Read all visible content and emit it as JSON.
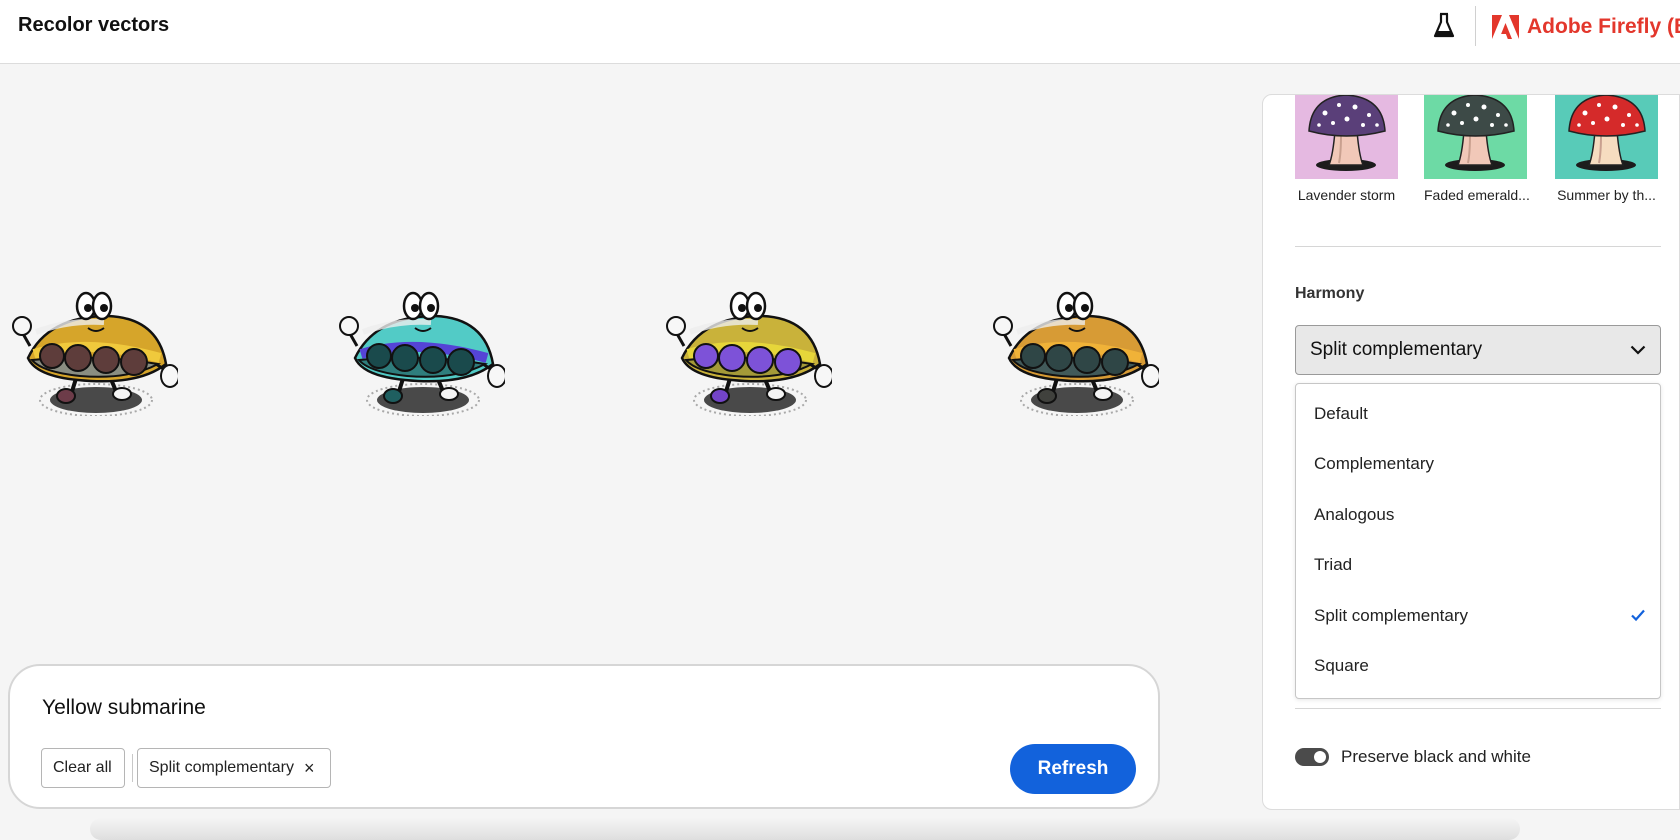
{
  "header": {
    "title": "Recolor vectors",
    "brand": "Adobe Firefly (Beta)",
    "icons": [
      "flask-icon",
      "adobe-logo-icon"
    ]
  },
  "variations": [
    {
      "name": "variation-1",
      "colors": {
        "bun": "#d6a52a",
        "body": "#fdfdf0",
        "belt": "#8a8e82",
        "spot": "#5e3d3b",
        "shoe": "#6d3c49",
        "accent": "#f0c93c"
      }
    },
    {
      "name": "variation-2",
      "colors": {
        "bun": "#52cbc6",
        "body": "#fdfdf0",
        "belt": "#2f7e7d",
        "spot": "#1a4a4c",
        "shoe": "#1f5f60",
        "accent": "#5544d6"
      }
    },
    {
      "name": "variation-3",
      "colors": {
        "bun": "#c9b23a",
        "body": "#fdfdf0",
        "belt": "#a49a38",
        "spot": "#7d52d8",
        "shoe": "#7344c8",
        "accent": "#e6d63a"
      }
    },
    {
      "name": "variation-4",
      "colors": {
        "bun": "#d79b35",
        "body": "#fdfdf0",
        "belt": "#425a5a",
        "spot": "#2f4646",
        "shoe": "#40413d",
        "accent": "#f0b238"
      }
    }
  ],
  "prompt": {
    "text": "Yellow submarine",
    "clear_label": "Clear all",
    "tag_label": "Split complementary",
    "tag_remove": "×",
    "refresh_label": "Refresh"
  },
  "panel": {
    "swatches": [
      {
        "label": "Lavender storm",
        "bg": "#e5b9e1",
        "cap": "#5a3f79",
        "stem": "#f1c8b8"
      },
      {
        "label": "Faded emerald...",
        "bg": "#6ddaa5",
        "cap": "#3d4a47",
        "stem": "#f1c8b8"
      },
      {
        "label": "Summer by th...",
        "bg": "#58cbb8",
        "cap": "#d52a2a",
        "stem": "#f6dcc0"
      }
    ],
    "harmony_label": "Harmony",
    "selected": "Split complementary",
    "options": [
      "Default",
      "Complementary",
      "Analogous",
      "Triad",
      "Split complementary",
      "Square"
    ],
    "checked_option": "Split complementary",
    "preserve_label": "Preserve black and white",
    "preserve_on": true
  },
  "colors": {
    "accent": "#1262dc",
    "brand": "#e3372c",
    "check": "#1262dc"
  }
}
